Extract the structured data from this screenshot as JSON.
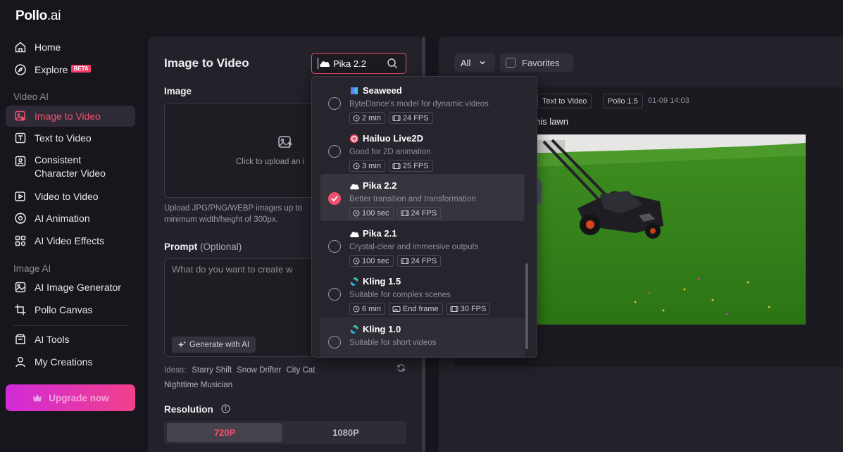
{
  "brand": {
    "name": "Pollo",
    "suffix": ".ai"
  },
  "sidebar": {
    "home": "Home",
    "explore": "Explore",
    "explore_badge": "BETA",
    "section_video": "Video AI",
    "image_to_video": "Image to Video",
    "text_to_video": "Text to Video",
    "consistent_1": "Consistent",
    "consistent_2": "Character Video",
    "video_to_video": "Video to Video",
    "ai_animation": "AI Animation",
    "ai_video_effects": "AI Video Effects",
    "section_image": "Image AI",
    "ai_image_generator": "AI Image Generator",
    "pollo_canvas": "Pollo Canvas",
    "ai_tools": "AI Tools",
    "my_creations": "My Creations",
    "upgrade": "Upgrade now"
  },
  "panel": {
    "title": "Image to Video",
    "model_value": "Pika 2.2",
    "image_label": "Image",
    "upload_text": "Click to upload an i",
    "hint_line1": "Upload JPG/PNG/WEBP images up to",
    "hint_line2": "minimum width/height of 300px.",
    "prompt_label": "Prompt",
    "prompt_optional": "(Optional)",
    "prompt_placeholder": "What do you want to create w",
    "generate_ai": "Generate with AI",
    "ideas_label": "Ideas:",
    "ideas": [
      "Starry Shift",
      "Snow Drifter",
      "City Cat",
      "Nighttime Musician"
    ],
    "resolution_label": "Resolution",
    "res_options": [
      "720P",
      "1080P"
    ],
    "res_selected": "720P"
  },
  "dropdown": {
    "items": [
      {
        "name": "Seaweed",
        "desc": "ByteDance's model for dynamic videos",
        "tags": [
          "2 min",
          "24 FPS"
        ],
        "selected": false
      },
      {
        "name": "Hailuo Live2D",
        "desc": "Good for 2D animation",
        "tags": [
          "3 min",
          "25 FPS"
        ],
        "selected": false
      },
      {
        "name": "Pika 2.2",
        "desc": "Better transition and transformation",
        "tags": [
          "100 sec",
          "24 FPS"
        ],
        "selected": true
      },
      {
        "name": "Pika 2.1",
        "desc": "Crystal-clear and immersive outputs",
        "tags": [
          "100 sec",
          "24 FPS"
        ],
        "selected": false
      },
      {
        "name": "Kling 1.5",
        "desc": "Suitable for complex scenes",
        "tags": [
          "6 min",
          "End frame",
          "30 FPS"
        ],
        "selected": false
      },
      {
        "name": "Kling 1.0",
        "desc": "Suitable for short videos",
        "tags": [],
        "selected": false
      }
    ]
  },
  "right": {
    "filter": "All",
    "favorites": "Favorites",
    "card_tags": [
      "Text to Video",
      "Pollo 1.5"
    ],
    "card_time": "01-09 14:03",
    "card_title": "his lawn"
  },
  "colors": {
    "accent": "#f0516e",
    "upgrade_from": "#d12ad9",
    "upgrade_to": "#f2408b"
  }
}
